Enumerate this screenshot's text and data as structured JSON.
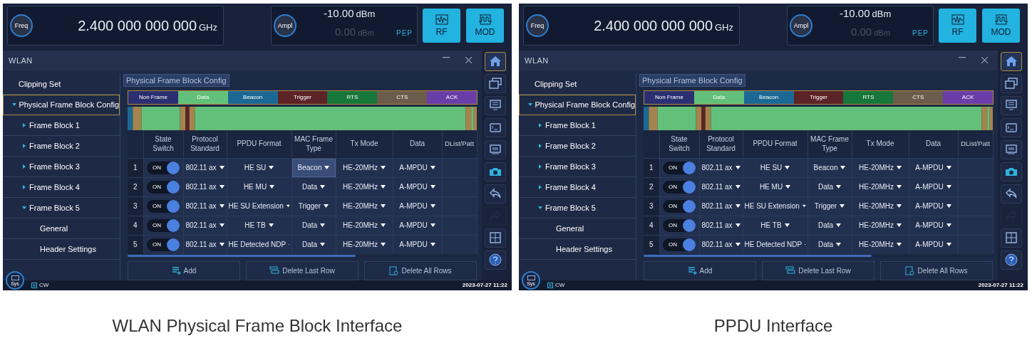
{
  "screens": [
    {
      "top": {
        "freq_label": "Freq",
        "freq_value": "2.400 000 000 000",
        "freq_unit": "GHz",
        "ampl_label": "Ampl",
        "ampl_value": "-10.00",
        "ampl_unit": "dBm",
        "pep_value": "0.00",
        "pep_unit": "dBm",
        "pep_label": "PEP",
        "buttons": [
          {
            "kind": "rf",
            "label": "RF"
          },
          {
            "kind": "mod",
            "label": "MOD"
          }
        ]
      },
      "window": {
        "title": "WLAN"
      },
      "sidebar": {
        "items": [
          {
            "label": "Clipping Set",
            "selected": false
          },
          {
            "label": "Physical Frame Block Config",
            "selected": true,
            "expanded": true,
            "children": [
              {
                "label": "Frame Block 1",
                "selected": false,
                "expanded": false
              },
              {
                "label": "Frame Block 2",
                "selected": false,
                "expanded": false
              },
              {
                "label": "Frame Block 3",
                "selected": false,
                "expanded": false
              },
              {
                "label": "Frame Block 4",
                "selected": false,
                "expanded": false
              },
              {
                "label": "Frame Block 5",
                "selected": false,
                "expanded": true,
                "children": [
                  {
                    "label": "General",
                    "selected": false
                  },
                  {
                    "label": "Header Settings",
                    "selected": false
                  }
                ]
              }
            ]
          }
        ]
      },
      "panel_title": "Physical Frame Block Config",
      "legend": [
        {
          "label": "Non Frame",
          "color": "#2b2f72"
        },
        {
          "label": "Data",
          "color": "#63c07a"
        },
        {
          "label": "Beacon",
          "color": "#1c6895"
        },
        {
          "label": "Trigger",
          "color": "#5c2327"
        },
        {
          "label": "RTS",
          "color": "#17763a"
        },
        {
          "label": "CTS",
          "color": "#6c5c4b"
        },
        {
          "label": "ACK",
          "color": "#6a3ea8"
        }
      ],
      "table": {
        "columns": [
          "State Switch",
          "Protocol Standard",
          "PPDU Format",
          "MAC Frame Type",
          "Tx Mode",
          "Data",
          "DList/Patt"
        ],
        "rows": [
          {
            "index": "1",
            "switch_label": "ON",
            "on": true,
            "protocol": "802.11 ax",
            "ppdu": "HE SU",
            "mac": "Beacon",
            "mac_selected": true,
            "tx_mode": "HE-20MHz",
            "data": "A-MPDU"
          },
          {
            "index": "2",
            "switch_label": "ON",
            "on": true,
            "protocol": "802.11 ax",
            "ppdu": "HE MU",
            "mac": "Data",
            "mac_selected": false,
            "tx_mode": "HE-20MHz",
            "data": "A-MPDU"
          },
          {
            "index": "3",
            "switch_label": "ON",
            "on": true,
            "protocol": "802.11 ax",
            "ppdu": "HE SU Extension",
            "mac": "Trigger",
            "mac_selected": false,
            "tx_mode": "HE-20MHz",
            "data": "A-MPDU"
          },
          {
            "index": "4",
            "switch_label": "ON",
            "on": true,
            "protocol": "802.11 ax",
            "ppdu": "HE TB",
            "mac": "Data",
            "mac_selected": false,
            "tx_mode": "HE-20MHz",
            "data": "A-MPDU"
          },
          {
            "index": "5",
            "switch_label": "ON",
            "on": true,
            "protocol": "802.11 ax",
            "ppdu": "HE Detected NDP",
            "mac": "Data",
            "mac_selected": false,
            "tx_mode": "HE-20MHz",
            "data": "A-MPDU"
          }
        ]
      },
      "actions": [
        {
          "kind": "add",
          "label": "Add"
        },
        {
          "kind": "delete-last",
          "label": "Delete Last Row"
        },
        {
          "kind": "delete-all",
          "label": "Delete All Rows"
        }
      ],
      "toolbar": [
        {
          "kind": "home",
          "selected": true,
          "disabled": false
        },
        {
          "kind": "windows",
          "selected": false,
          "disabled": false
        },
        {
          "kind": "monitor",
          "selected": false,
          "disabled": false
        },
        {
          "kind": "terminal",
          "selected": false,
          "disabled": false
        },
        {
          "kind": "scpi",
          "selected": false,
          "disabled": false
        },
        {
          "kind": "camera",
          "selected": false,
          "disabled": false
        },
        {
          "kind": "undo",
          "selected": false,
          "disabled": false
        },
        {
          "kind": "redo",
          "selected": false,
          "disabled": true
        },
        {
          "kind": "layout",
          "selected": false,
          "disabled": false
        },
        {
          "kind": "help",
          "selected": false,
          "disabled": false
        }
      ],
      "status": {
        "sys_label": "Sys",
        "mode": "CW",
        "datetime": "2023-07-27 11:22"
      },
      "caption": "WLAN Physical Frame Block Interface"
    },
    {
      "top": {
        "freq_label": "Freq",
        "freq_value": "2.400 000 000 000",
        "freq_unit": "GHz",
        "ampl_label": "Ampl",
        "ampl_value": "-10.00",
        "ampl_unit": "dBm",
        "pep_value": "0.00",
        "pep_unit": "dBm",
        "pep_label": "PEP",
        "buttons": [
          {
            "kind": "rf",
            "label": "RF"
          },
          {
            "kind": "mod",
            "label": "MOD"
          }
        ]
      },
      "window": {
        "title": "WLAN"
      },
      "sidebar": {
        "items": [
          {
            "label": "Clipping Set",
            "selected": false
          },
          {
            "label": "Physical Frame Block Config",
            "selected": true,
            "expanded": true,
            "children": [
              {
                "label": "Frame Block 1",
                "selected": false,
                "expanded": false
              },
              {
                "label": "Frame Block 2",
                "selected": false,
                "expanded": false
              },
              {
                "label": "Frame Block 3",
                "selected": false,
                "expanded": false
              },
              {
                "label": "Frame Block 4",
                "selected": false,
                "expanded": false
              },
              {
                "label": "Frame Block 5",
                "selected": false,
                "expanded": true,
                "children": [
                  {
                    "label": "General",
                    "selected": false
                  },
                  {
                    "label": "Header Settings",
                    "selected": false
                  }
                ]
              }
            ]
          }
        ]
      },
      "panel_title": "Physical Frame Block Config",
      "legend": [
        {
          "label": "Non Frame",
          "color": "#2b2f72"
        },
        {
          "label": "Data",
          "color": "#63c07a"
        },
        {
          "label": "Beacon",
          "color": "#1c6895"
        },
        {
          "label": "Trigger",
          "color": "#5c2327"
        },
        {
          "label": "RTS",
          "color": "#17763a"
        },
        {
          "label": "CTS",
          "color": "#6c5c4b"
        },
        {
          "label": "ACK",
          "color": "#6a3ea8"
        }
      ],
      "table": {
        "columns": [
          "State Switch",
          "Protocol Standard",
          "PPDU Format",
          "MAC Frame Type",
          "Tx Mode",
          "Data",
          "DList/Patt"
        ],
        "rows": [
          {
            "index": "1",
            "switch_label": "ON",
            "on": true,
            "protocol": "802.11 ax",
            "ppdu": "HE SU",
            "mac": "Beacon",
            "mac_selected": false,
            "tx_mode": "HE-20MHz",
            "data": "A-MPDU"
          },
          {
            "index": "2",
            "switch_label": "ON",
            "on": true,
            "protocol": "802.11 ax",
            "ppdu": "HE MU",
            "mac": "Data",
            "mac_selected": false,
            "tx_mode": "HE-20MHz",
            "data": "A-MPDU"
          },
          {
            "index": "3",
            "switch_label": "ON",
            "on": true,
            "protocol": "802.11 ax",
            "ppdu": "HE SU Extension",
            "mac": "Trigger",
            "mac_selected": false,
            "tx_mode": "HE-20MHz",
            "data": "A-MPDU"
          },
          {
            "index": "4",
            "switch_label": "ON",
            "on": true,
            "protocol": "802.11 ax",
            "ppdu": "HE TB",
            "mac": "Data",
            "mac_selected": false,
            "tx_mode": "HE-20MHz",
            "data": "A-MPDU"
          },
          {
            "index": "5",
            "switch_label": "ON",
            "on": true,
            "protocol": "802.11 ax",
            "ppdu": "HE Detected NDP",
            "mac": "Data",
            "mac_selected": false,
            "tx_mode": "HE-20MHz",
            "data": "A-MPDU"
          }
        ]
      },
      "actions": [
        {
          "kind": "add",
          "label": "Add"
        },
        {
          "kind": "delete-last",
          "label": "Delete Last Row"
        },
        {
          "kind": "delete-all",
          "label": "Delete All Rows"
        }
      ],
      "toolbar": [
        {
          "kind": "home",
          "selected": true,
          "disabled": false
        },
        {
          "kind": "windows",
          "selected": false,
          "disabled": false
        },
        {
          "kind": "monitor",
          "selected": false,
          "disabled": false
        },
        {
          "kind": "terminal",
          "selected": false,
          "disabled": false
        },
        {
          "kind": "scpi",
          "selected": false,
          "disabled": false
        },
        {
          "kind": "camera",
          "selected": false,
          "disabled": false
        },
        {
          "kind": "undo",
          "selected": false,
          "disabled": false
        },
        {
          "kind": "redo",
          "selected": false,
          "disabled": true
        },
        {
          "kind": "layout",
          "selected": false,
          "disabled": false
        },
        {
          "kind": "help",
          "selected": false,
          "disabled": false
        }
      ],
      "status": {
        "sys_label": "Sys",
        "mode": "CW",
        "datetime": "2023-07-27 11:22"
      },
      "caption": "PPDU Interface"
    }
  ]
}
